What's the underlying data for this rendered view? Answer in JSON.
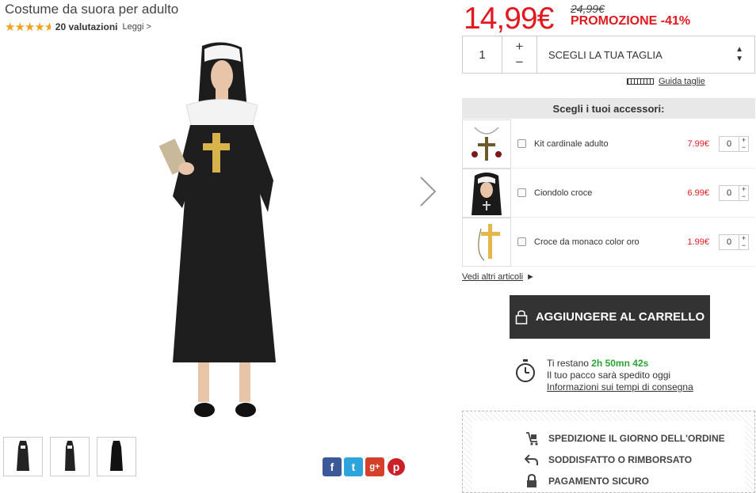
{
  "product": {
    "title": "Costume da suora per adulto",
    "rating_stars": 4.5,
    "rating_count": "20 valutazioni",
    "read_link": "Leggi >"
  },
  "price": {
    "current": "14,99€",
    "old": "24,99€",
    "promo": "PROMOZIONE -41%"
  },
  "order": {
    "quantity": "1",
    "plus": "+",
    "minus": "−",
    "size_label": "SCEGLI LA TUA TAGLIA",
    "size_guide": "Guida taglie"
  },
  "accessories": {
    "title": "Scegli i tuoi accessori:",
    "items": [
      {
        "name": "Kit cardinale adulto",
        "price": "7.99€",
        "qty": "0"
      },
      {
        "name": "Ciondolo croce",
        "price": "6.99€",
        "qty": "0"
      },
      {
        "name": "Croce da monaco color oro",
        "price": "1.99€",
        "qty": "0"
      }
    ],
    "more_link": "Vedi altri articoli",
    "more_arrow": "►"
  },
  "cart": {
    "button_label": "AGGIUNGERE AL CARRELLO"
  },
  "delivery": {
    "prefix": "Ti restano ",
    "time": "2h 50mn 42s",
    "line2": "Il tuo pacco sarà spedito oggi",
    "link": "Informazioni sui tempi di consegna"
  },
  "trust": [
    {
      "icon": "trolley-icon",
      "label": "SPEDIZIONE IL GIORNO DELL'ORDINE"
    },
    {
      "icon": "return-arrow-icon",
      "label": "SODDISFATTO O RIMBORSATO"
    },
    {
      "icon": "lock-icon",
      "label": "PAGAMENTO SICURO"
    }
  ],
  "social": [
    "facebook-icon",
    "twitter-icon",
    "google-plus-icon",
    "pinterest-icon"
  ],
  "colors": {
    "accent": "#e2191f",
    "timer": "#2aa334",
    "button": "#333333"
  }
}
